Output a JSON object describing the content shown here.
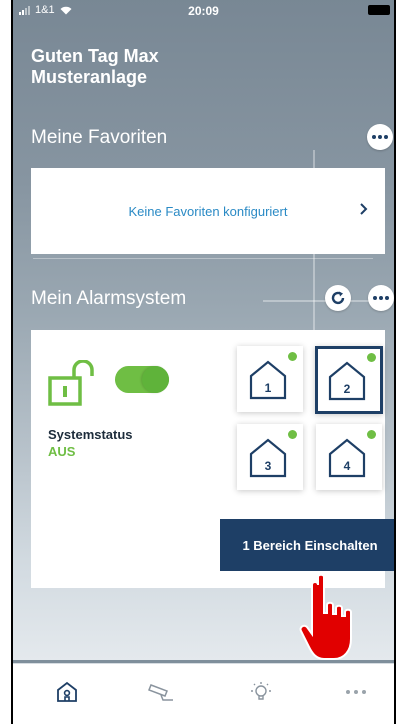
{
  "status_bar": {
    "carrier": "1&1",
    "time": "20:09"
  },
  "greeting": {
    "line1": "Guten Tag Max",
    "line2": "Musteranlage"
  },
  "favorites": {
    "title": "Meine Favoriten",
    "empty_text": "Keine Favoriten konfiguriert"
  },
  "alarm": {
    "title": "Mein Alarmsystem",
    "status_label": "Systemstatus",
    "status_value": "AUS",
    "zones": [
      "1",
      "2",
      "3",
      "4"
    ],
    "selected_zone": "2",
    "activate_label": "1 Bereich Einschalten"
  },
  "colors": {
    "primary": "#1e3f66",
    "accent_green": "#6fbe44",
    "link_blue": "#2a8ac5"
  },
  "tabbar": {
    "items": [
      "home-icon",
      "camera-icon",
      "lightbulb-icon",
      "more-icon"
    ]
  }
}
